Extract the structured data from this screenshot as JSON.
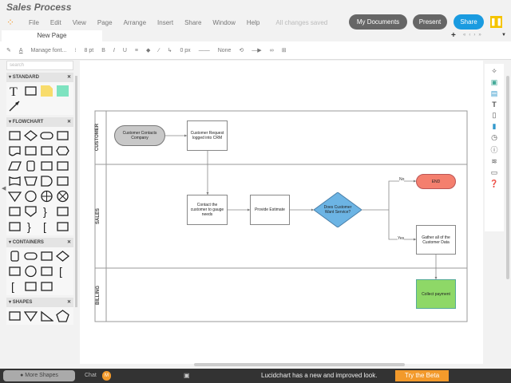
{
  "app": {
    "title": "Sales Process",
    "status": "All changes saved"
  },
  "menu": [
    "File",
    "Edit",
    "View",
    "Page",
    "Arrange",
    "Insert",
    "Share",
    "Window",
    "Help"
  ],
  "buttons": {
    "my_documents": "My Documents",
    "present": "Present",
    "share": "Share"
  },
  "colors": {
    "share": "#1a9be0",
    "pill": "#666666",
    "accent": "#f39a2b",
    "end": "#f47f6e",
    "decision": "#6cb4e4",
    "payment": "#8ed867",
    "start": "#c8c8c8"
  },
  "tabs": [
    {
      "label": "New Page"
    }
  ],
  "toolbar": {
    "font": "Manage font...",
    "size": "8 pt",
    "bold": "B",
    "italic": "I",
    "underline": "U",
    "line_width": "0 px",
    "arrow_start": "None"
  },
  "sidebar": {
    "search_placeholder": "search",
    "sections": [
      {
        "title": "STANDARD",
        "shapes": [
          "text",
          "rect",
          "note",
          "filled-rect",
          "arrow"
        ]
      },
      {
        "title": "FLOWCHART",
        "shapes": [
          "rect",
          "diamond",
          "pill",
          "rect",
          "doc",
          "rect",
          "rect",
          "hex",
          "para",
          "cyl",
          "rect",
          "rect",
          "wave",
          "trap",
          "delay",
          "rect",
          "tri",
          "circle",
          "cross",
          "xcircle",
          "rect",
          "shield",
          "brace",
          "rect",
          "rect",
          "brace",
          "bracket",
          "rect"
        ]
      },
      {
        "title": "CONTAINERS",
        "shapes": [
          "cyl",
          "pill",
          "rect",
          "diamond",
          "rect",
          "circle",
          "rect",
          "bracket",
          "bracket",
          "rect",
          "rect"
        ]
      },
      {
        "title": "SHAPES",
        "shapes": [
          "rect",
          "tri",
          "rtri",
          "pent"
        ]
      }
    ]
  },
  "diagram": {
    "lanes": [
      "CUSTOMER",
      "SALES",
      "BILLING"
    ],
    "nodes": {
      "start": "Customer Contacts Company",
      "request": "Customer Request logged into CRM",
      "contact": "Contact the customer to gauge needs",
      "estimate": "Provide Estimate",
      "decision": "Does Customer Want Service?",
      "end": "END",
      "gather": "Gather all of the Customer Data",
      "payment": "Collect payment"
    },
    "labels": {
      "no": "No",
      "yes": "Yes"
    }
  },
  "right_toolbar": [
    "compass",
    "image",
    "image-2",
    "text",
    "page",
    "doc",
    "history",
    "info",
    "layers",
    "present",
    "help"
  ],
  "bottom": {
    "more_shapes": "More Shapes",
    "chat": "Chat",
    "chat_count": "M",
    "banner": "Lucidchart has a new and improved look.",
    "try_beta": "Try the Beta"
  }
}
